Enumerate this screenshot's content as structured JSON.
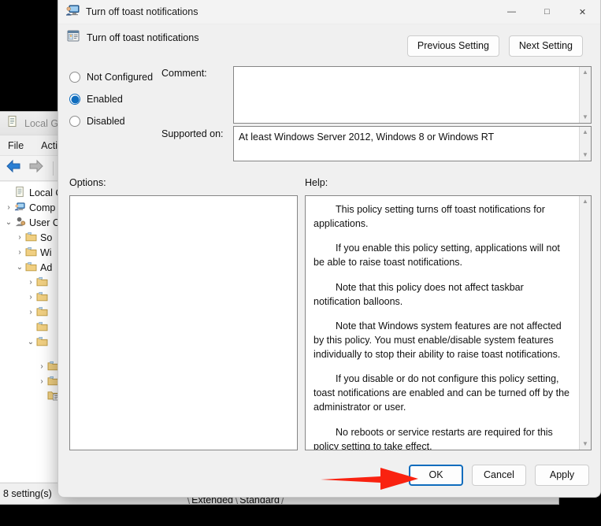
{
  "dialog": {
    "title": "Turn off toast notifications",
    "header_title": "Turn off toast notifications",
    "title_icon": "policy-computer-icon",
    "header_icon": "policy-setting-icon",
    "window_controls": {
      "minimize": "—",
      "maximize": "□",
      "close": "✕"
    },
    "nav": {
      "previous": "Previous Setting",
      "next": "Next Setting"
    },
    "state_options": [
      {
        "label": "Not Configured",
        "selected": false
      },
      {
        "label": "Enabled",
        "selected": true
      },
      {
        "label": "Disabled",
        "selected": false
      }
    ],
    "labels": {
      "comment": "Comment:",
      "supported_on": "Supported on:",
      "options": "Options:",
      "help": "Help:"
    },
    "comment_value": "",
    "supported_on_value": "At least Windows Server 2012, Windows 8 or Windows RT",
    "options_value": "",
    "help_paragraphs": [
      "This policy setting turns off toast notifications for applications.",
      "If you enable this policy setting, applications will not be able to raise toast notifications.",
      "Note that this policy does not affect taskbar notification balloons.",
      "Note that Windows system features are not affected by this policy.  You must enable/disable system features individually to stop their ability to raise toast notifications.",
      "If you disable or do not configure this policy setting, toast notifications are enabled and can be turned off by the administrator or user.",
      "No reboots or service restarts are required for this policy setting to take effect."
    ],
    "footer": {
      "ok": "OK",
      "cancel": "Cancel",
      "apply": "Apply"
    }
  },
  "background_window": {
    "title": "Local Gro",
    "title_icon": "gpedit-scroll-icon",
    "menus": [
      "File",
      "Action"
    ],
    "toolbar_icons": [
      "back-arrow-icon",
      "forward-arrow-icon",
      "up-folder-icon"
    ],
    "tree": [
      {
        "chevron": "",
        "label": "Local Con",
        "icon": "gpedit-scroll-icon",
        "indent": 0
      },
      {
        "chevron": "›",
        "label": "Comp",
        "icon": "computer-icon",
        "indent": 1
      },
      {
        "chevron": "⌄",
        "label": "User C",
        "icon": "user-icon",
        "indent": 1
      },
      {
        "chevron": "›",
        "label": "So",
        "icon": "folder-icon",
        "indent": 2
      },
      {
        "chevron": "›",
        "label": "Wi",
        "icon": "folder-icon",
        "indent": 2
      },
      {
        "chevron": "⌄",
        "label": "Ad",
        "icon": "folder-icon",
        "indent": 2
      },
      {
        "chevron": "›",
        "label": "",
        "icon": "folder-icon",
        "indent": 3
      },
      {
        "chevron": "›",
        "label": "",
        "icon": "folder-icon",
        "indent": 3
      },
      {
        "chevron": "›",
        "label": "",
        "icon": "folder-icon",
        "indent": 3
      },
      {
        "chevron": "",
        "label": "",
        "icon": "folder-icon",
        "indent": 3
      },
      {
        "chevron": "⌄",
        "label": "",
        "icon": "folder-icon",
        "indent": 3
      },
      {
        "chevron": "›",
        "label": "",
        "icon": "folder-icon",
        "indent": 4
      },
      {
        "chevron": "›",
        "label": "",
        "icon": "folder-icon",
        "indent": 4
      },
      {
        "chevron": "",
        "label": "",
        "icon": "folder-settings-icon",
        "indent": 4
      }
    ],
    "tabs": [
      "Extended",
      "Standard"
    ],
    "status": "8 setting(s)"
  },
  "annotation": {
    "arrow_color": "#f92210",
    "points_to": "OK"
  },
  "colors": {
    "accent": "#0f6cbd",
    "dialog_bg": "#f0f0f0",
    "field_bg": "#ffffff",
    "border": "#868686"
  }
}
